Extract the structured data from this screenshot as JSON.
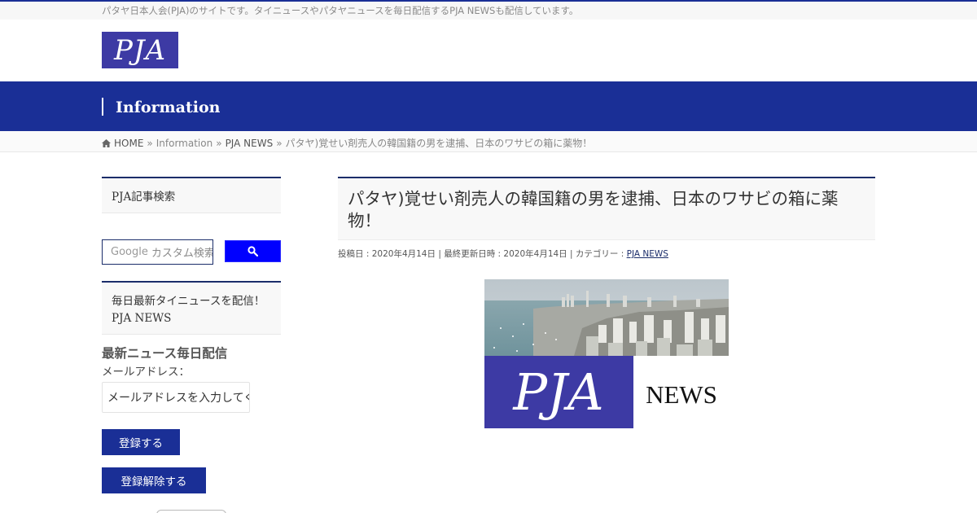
{
  "site": {
    "tagline": "パタヤ日本人会(PJA)のサイトです。タイニュースやパタヤニュースを毎日配信するPJA NEWSも配信しています。",
    "logo_text": "PJA"
  },
  "header_band": {
    "title": "Information"
  },
  "breadcrumb": {
    "home": "HOME",
    "sep": "»",
    "items": [
      "Information",
      "PJA NEWS"
    ],
    "current": "パタヤ)覚せい剤売人の韓国籍の男を逮捕、日本のワサビの箱に薬物！"
  },
  "sidebar": {
    "search_title": "PJA記事検索",
    "search_placeholder": "カスタム検索",
    "google_label": "Google",
    "news_title_line1": "毎日最新タイニュースを配信！",
    "news_title_line2": "PJA NEWS",
    "newsletter_title": "最新ニュース毎日配信",
    "email_label": "メールアドレス：",
    "email_placeholder": "メールアドレスを入力してください",
    "subscribe_label": "登録する",
    "unsubscribe_label": "登録解除する"
  },
  "post": {
    "title": "パタヤ)覚せい剤売人の韓国籍の男を逮捕、日本のワサビの箱に薬物！",
    "posted_label": "投稿日 : ",
    "posted_date": "2020年4月14日",
    "updated_label": " | 最終更新日時 : ",
    "updated_date": "2020年4月14日",
    "category_label": " | カテゴリー : ",
    "category": "PJA NEWS"
  },
  "featured_image": {
    "logo_text": "PJA",
    "news_text": "NEWS"
  },
  "colors": {
    "brand_blue": "#1a2f96",
    "logo_blue": "#3d3aa4",
    "search_button": "#0000ff",
    "border_navy": "#1b2d6a"
  },
  "icons": {
    "home": "home-icon",
    "search": "search-icon"
  }
}
